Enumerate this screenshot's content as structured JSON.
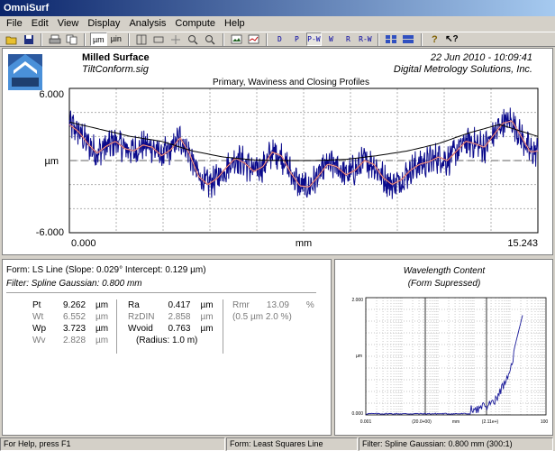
{
  "app": {
    "title": "OmniSurf"
  },
  "menu": [
    "File",
    "Edit",
    "View",
    "Display",
    "Analysis",
    "Compute",
    "Help"
  ],
  "toolbar": {
    "unit_um": "µm",
    "unit_uin": "µin",
    "profile_buttons": [
      "D",
      "P",
      "P-W",
      "W",
      "R",
      "R-W"
    ],
    "icons": [
      "open-folder-icon",
      "save-icon",
      "print-icon",
      "copy-icon",
      "zoom-in-icon",
      "zoom-out-icon",
      "help-icon",
      "context-help-icon"
    ]
  },
  "header": {
    "surface_name": "Milled Surface",
    "file_name": "TiltConform.sig",
    "datetime": "22 Jun 2010 - 10:09:41",
    "company": "Digital Metrology Solutions, Inc.",
    "chart_title": "Primary, Waviness and Closing Profiles"
  },
  "chart_data": {
    "type": "line",
    "title": "Primary, Waviness and Closing Profiles",
    "xlabel": "mm",
    "ylabel": "µm",
    "xlim": [
      0.0,
      15.243
    ],
    "ylim": [
      -6.0,
      6.0
    ],
    "x_tick_labels": [
      "0.000",
      "15.243"
    ],
    "y_tick_labels": [
      "6.000",
      "-6.000"
    ],
    "mean_line": 0.0,
    "grid": true,
    "series_colors": {
      "primary": "#0a0a8c",
      "waviness": "#c83c32",
      "closing": "#000000"
    },
    "waviness_x": [
      0.0,
      0.3,
      0.6,
      0.9,
      1.2,
      1.5,
      1.8,
      2.1,
      2.4,
      2.7,
      3.0,
      3.3,
      3.6,
      3.9,
      4.2,
      4.5,
      4.8,
      5.1,
      5.4,
      5.7,
      6.0,
      6.3,
      6.6,
      6.9,
      7.2,
      7.5,
      7.8,
      8.1,
      8.4,
      8.7,
      9.0,
      9.3,
      9.6,
      9.9,
      10.2,
      10.5,
      10.8,
      11.1,
      11.4,
      11.7,
      12.0,
      12.3,
      12.6,
      12.9,
      13.2,
      13.5,
      13.8,
      14.1,
      14.4,
      14.7,
      15.0,
      15.243
    ],
    "waviness_y": [
      3.0,
      2.4,
      1.4,
      0.6,
      1.2,
      1.6,
      1.0,
      0.8,
      1.3,
      1.1,
      0.4,
      0.9,
      1.9,
      0.6,
      -1.3,
      -2.0,
      -1.5,
      -0.6,
      0.2,
      -0.2,
      -0.9,
      -0.5,
      0.7,
      0.4,
      -1.0,
      -2.1,
      -2.2,
      -1.3,
      -0.3,
      -0.5,
      -1.2,
      -0.8,
      0.0,
      -0.3,
      -1.4,
      -2.0,
      -1.6,
      -0.8,
      -0.3,
      -0.1,
      0.3,
      0.0,
      0.8,
      1.6,
      1.4,
      1.1,
      2.1,
      3.1,
      3.3,
      2.0,
      0.7,
      0.8
    ],
    "closing_x": [
      0.0,
      1.0,
      2.0,
      3.0,
      4.0,
      5.0,
      6.0,
      7.0,
      8.0,
      9.0,
      10.0,
      11.0,
      12.0,
      13.0,
      14.0,
      15.243
    ],
    "closing_y": [
      3.2,
      2.6,
      2.0,
      1.6,
      0.8,
      0.3,
      0.05,
      0.0,
      0.0,
      0.1,
      0.4,
      0.8,
      1.4,
      2.3,
      3.0,
      2.0
    ]
  },
  "form_info": {
    "form_line": "Form: LS Line   (Slope: 0.029°  Intercept: 0.129 µm)",
    "filter_line": "Filter: Spline Gaussian: 0.800 mm"
  },
  "parameters": {
    "col1": [
      {
        "name": "Pt",
        "value": "9.262",
        "unit": "µm",
        "grey": false
      },
      {
        "name": "Wt",
        "value": "6.552",
        "unit": "µm",
        "grey": true
      },
      {
        "name": "Wp",
        "value": "3.723",
        "unit": "µm",
        "grey": false
      },
      {
        "name": "Wv",
        "value": "2.828",
        "unit": "µm",
        "grey": true
      }
    ],
    "col2": [
      {
        "name": "Ra",
        "value": "0.417",
        "unit": "µm",
        "grey": false
      },
      {
        "name": "RzDIN",
        "value": "2.858",
        "unit": "µm",
        "grey": true
      },
      {
        "name": "Wvoid",
        "value": "0.763",
        "unit": "µm",
        "grey": false
      },
      {
        "name": "(Radius: 1.0 m)",
        "value": "",
        "unit": "",
        "grey": false
      }
    ],
    "col3": [
      {
        "name": "Rmr",
        "value": "13.09",
        "unit": "%",
        "grey": true
      },
      {
        "name": "(0.5 µm  2.0 %)",
        "value": "",
        "unit": "",
        "grey": true
      }
    ]
  },
  "wavelength": {
    "title": "Wavelength Content",
    "subtitle": "(Form Supressed)",
    "ytick_top": "2.000",
    "ytick_bottom": "0.000",
    "ylabel": "µm",
    "xlabels": [
      "0.001",
      "(20.0+00)",
      "mm",
      "(2.11e+)",
      "100"
    ]
  },
  "statusbar": {
    "help": "For Help, press F1",
    "form": "Form: Least Squares Line",
    "filter": "Filter: Spline Gaussian: 0.800 mm (300:1)"
  }
}
